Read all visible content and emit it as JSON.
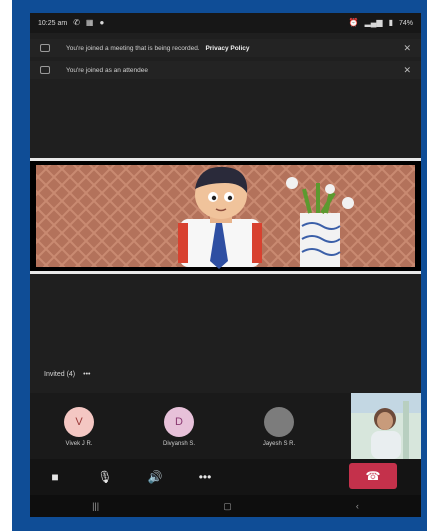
{
  "statusbar": {
    "time": "10:25 am",
    "left_icons": [
      "phone-icon",
      "teams-icon",
      "chat-icon"
    ],
    "right_icons": [
      "alarm-icon",
      "signal-icon",
      "battery-icon"
    ],
    "battery": "74%"
  },
  "notices": [
    {
      "text": "You're joined a meeting that is being recorded.",
      "link": "Privacy Policy",
      "icon": "info-icon"
    },
    {
      "text": "You're joined as an attendee",
      "link": "",
      "icon": "info-icon"
    }
  ],
  "section_label": "Invited (4)",
  "section_more": "•••",
  "participants": [
    {
      "initial": "V",
      "name": "Vivek J R.",
      "color": "#f4c7c3",
      "fg": "#9b3a3a"
    },
    {
      "initial": "D",
      "name": "Divyansh S.",
      "color": "#e7c1d9",
      "fg": "#8a3972"
    },
    {
      "initial": "",
      "name": "Jayesh S R.",
      "color": "#7c7c7c",
      "fg": "#ffffff"
    }
  ],
  "controls": [
    {
      "name": "camera-icon",
      "glyph": "■"
    },
    {
      "name": "mic-off-icon",
      "glyph": "🎙"
    },
    {
      "name": "speaker-icon",
      "glyph": "🔊"
    },
    {
      "name": "more-icon",
      "glyph": "•••"
    }
  ],
  "hangup_glyph": "☎",
  "navbar": [
    "|||",
    "▢",
    "‹"
  ]
}
